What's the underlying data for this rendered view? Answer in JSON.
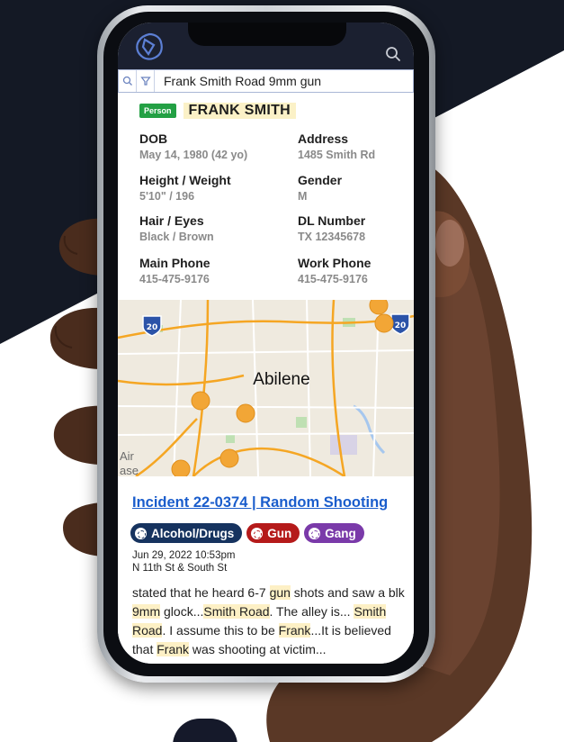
{
  "colors": {
    "header_bg": "#1b2030",
    "link": "#1a5dcc",
    "person_badge": "#23a044",
    "highlight": "#fdf0c5",
    "tag_alcohol": "#16335f",
    "tag_gun": "#b51a1a",
    "tag_gang": "#7a3aa9"
  },
  "search": {
    "query": "Frank Smith Road 9mm gun"
  },
  "person": {
    "badge": "Person",
    "name": "FRANK SMITH",
    "fields": [
      {
        "label": "DOB",
        "value": "May 14, 1980 (42 yo)"
      },
      {
        "label": "Address",
        "value": "1485 Smith Rd"
      },
      {
        "label": "Height / Weight",
        "value": "5'10\" / 196"
      },
      {
        "label": "Gender",
        "value": "M"
      },
      {
        "label": "Hair / Eyes",
        "value": "Black / Brown"
      },
      {
        "label": "DL Number",
        "value": "TX 12345678"
      },
      {
        "label": "Main Phone",
        "value": "415-475-9176"
      },
      {
        "label": "Work Phone",
        "value": "415-475-9176"
      }
    ]
  },
  "map": {
    "city": "Abilene",
    "highway_shields": [
      "20",
      "20"
    ],
    "corner_text": [
      "Air",
      "ase"
    ]
  },
  "incident": {
    "title": "Incident 22-0374 | Random Shooting",
    "tags": [
      "Alcohol/Drugs",
      "Gun",
      "Gang"
    ],
    "date": "Jun 29, 2022 10:53pm",
    "location": "N 11th St & South St",
    "narrative": {
      "t1": "stated that he heard 6-7 ",
      "h1": "gun",
      "t2": " shots and saw a blk ",
      "h2": "9mm",
      "t3": " glock...",
      "h3": "Smith Road",
      "t4": ". The alley is... ",
      "h4": "Smith Road",
      "t5": ". I assume this to be ",
      "h5": "Frank",
      "t6": "...It is believed that ",
      "h6": "Frank",
      "t7": " was shooting at victim..."
    }
  }
}
